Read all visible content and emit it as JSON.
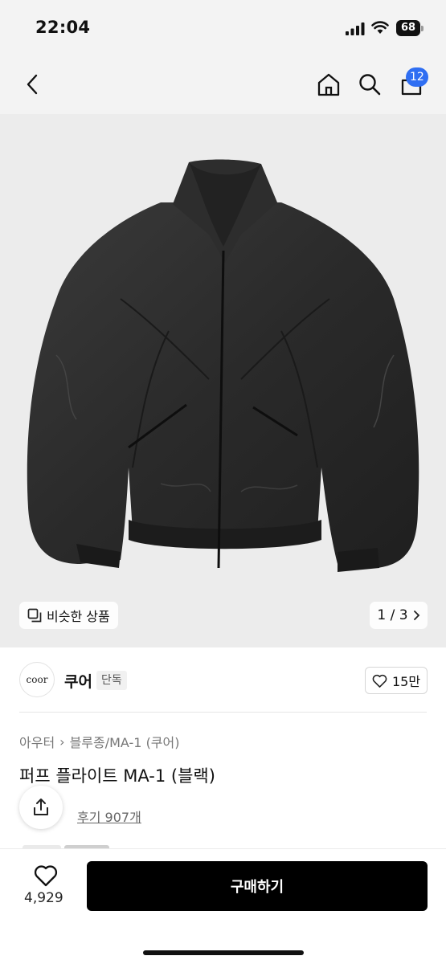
{
  "status_bar": {
    "time": "22:04",
    "battery": "68"
  },
  "nav": {
    "cart_badge": "12",
    "icons": [
      "back-icon",
      "home-icon",
      "search-icon",
      "cart-icon"
    ]
  },
  "gallery": {
    "similar_label": "비슷한 상품",
    "page_indicator": "1 / 3"
  },
  "brand": {
    "logo_text": "coor",
    "name": "쿠어",
    "tag": "단독",
    "likes": "15만"
  },
  "product": {
    "breadcrumb": [
      "아우터",
      "블루종/MA-1 (쿠어)"
    ],
    "title": "퍼프 플라이트 MA-1 (블랙)",
    "review_label": "후기 907개"
  },
  "bottom_bar": {
    "wish_count": "4,929",
    "buy_label": "구매하기"
  },
  "colors": {
    "accent_badge": "#2f6ef2",
    "buy_button": "#000000"
  }
}
